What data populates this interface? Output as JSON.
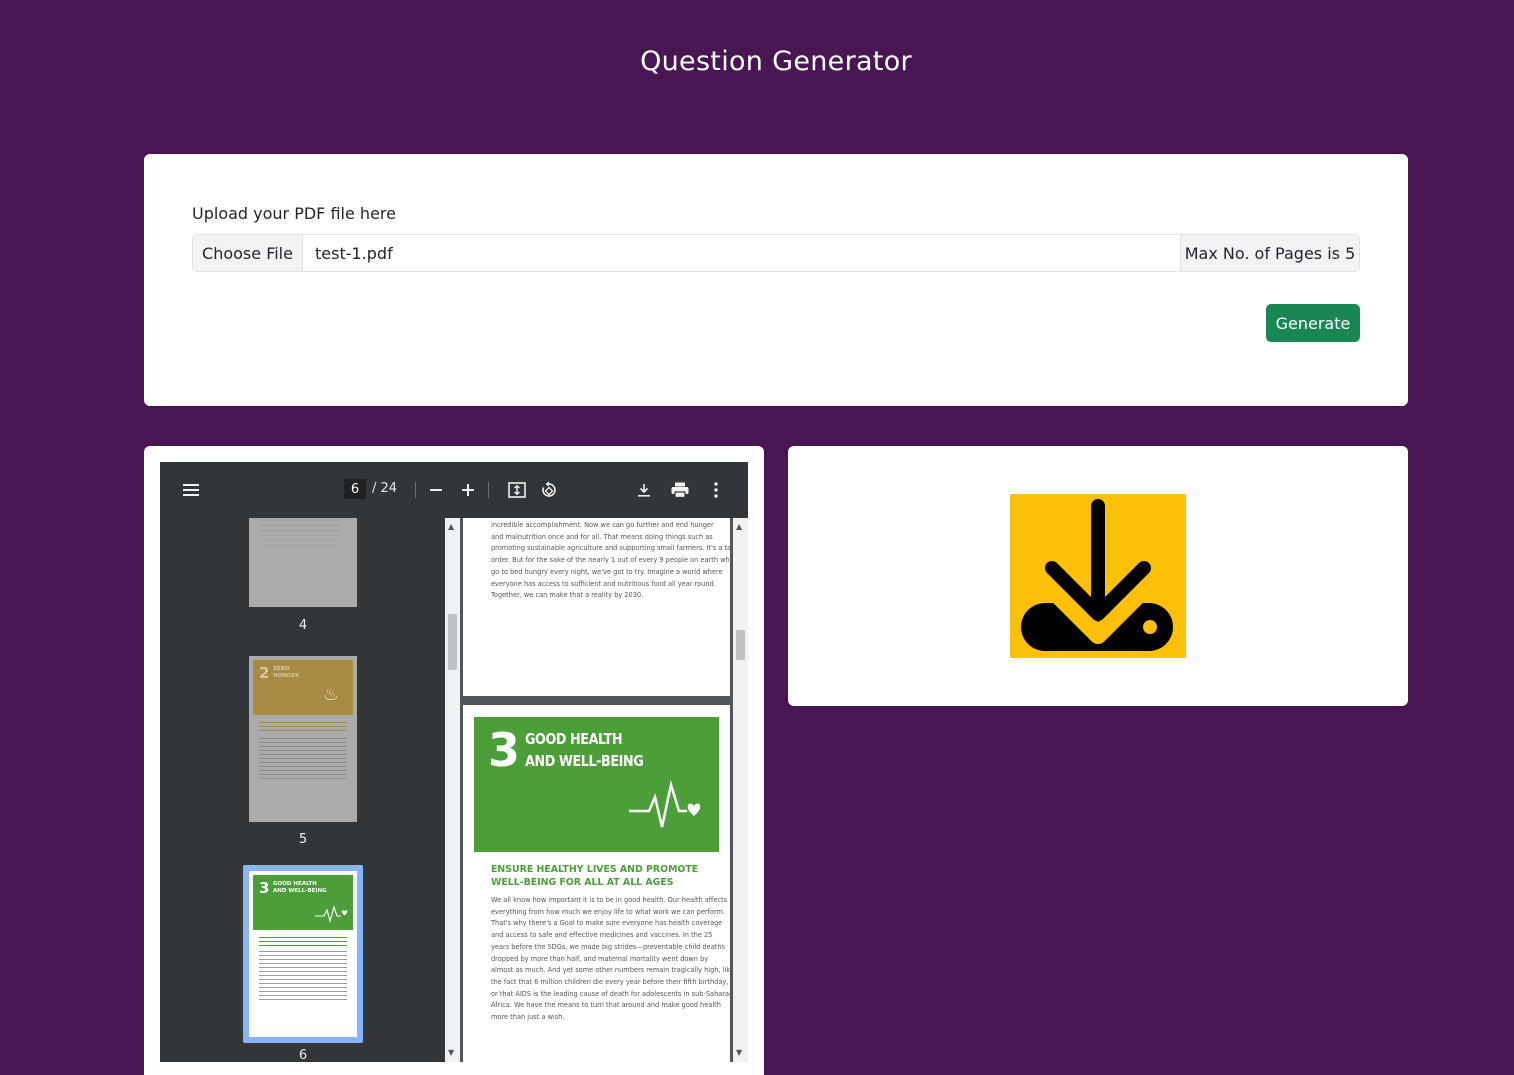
{
  "header": {
    "title": "Question Generator"
  },
  "upload": {
    "label": "Upload your PDF file here",
    "choose_button": "Choose File",
    "file_name": "test-1.pdf",
    "max_pages": "Max No. of Pages is 5",
    "generate_button": "Generate"
  },
  "pdf_viewer": {
    "current_page": "6",
    "total_pages": "/ 24",
    "thumbnails": [
      {
        "number": "4"
      },
      {
        "number": "5",
        "badge": "2",
        "title": "ZERO\nHUNGER"
      },
      {
        "number": "6",
        "badge": "3",
        "title": "GOOD HEALTH\nAND WELL-BEING"
      }
    ],
    "page5_text": "incredible accomplishment. Now we can go further and end hunger\nand malnutrition once and for all. That means doing things such as\npromoting sustainable agriculture and supporting small farmers. It's a tall\norder. But for the sake of the nearly 1 out of every 9 people on earth who\ngo to bed hungry every night, we've got to try. Imagine a world where\neveryone has access to sufficient and nutritious food all year round.\nTogether, we can make that a reality by 2030.",
    "page6": {
      "goal_number": "3",
      "goal_title_line1": "GOOD HEALTH",
      "goal_title_line2": "AND WELL-BEING",
      "subtitle": "ENSURE HEALTHY LIVES AND PROMOTE\nWELL-BEING FOR ALL AT ALL AGES",
      "body": "We all know how important it is to be in good health. Our health affects\neverything from how much we enjoy life to what work we can perform.\nThat's why there's a Goal to make sure everyone has health coverage\nand access to safe and effective medicines and vaccines. In the 25\nyears before the SDGs, we made big strides—preventable child deaths\ndropped by more than half, and maternal mortality went down by\nalmost as much. And yet some other numbers remain tragically high, like\nthe fact that 6 million children die every year before their fifth birthday,\nor that AIDS is the leading cause of death for adolescents in sub-Saharan\nAfrica. We have the means to turn that around and make good health\nmore than just a wish."
    }
  },
  "colors": {
    "background": "#481753",
    "generate": "#198754",
    "sdg3_green": "#4c9f38",
    "sdg2_gold": "#d3a029",
    "download_yellow": "#fdc009"
  }
}
